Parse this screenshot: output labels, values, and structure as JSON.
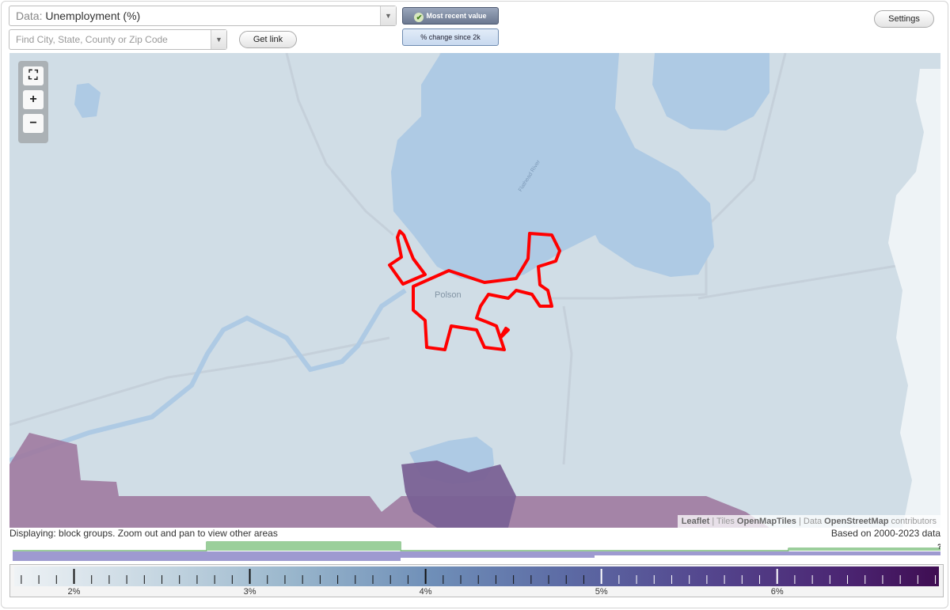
{
  "header": {
    "data_prefix": "Data:",
    "data_value": "Unemployment (%)",
    "search_placeholder": "Find City, State, County or Zip Code",
    "get_link": "Get link",
    "toggle_recent": "Most recent value",
    "toggle_change": "% change since 2k",
    "settings": "Settings"
  },
  "map": {
    "place_label": "Polson",
    "river_label": "Flathead River",
    "zoom_fit_icon": "fullscreen-icon",
    "zoom_in": "+",
    "zoom_out": "−",
    "colors": {
      "land": "#d0dde6",
      "water": "#aecae4",
      "road": "#c5d0da",
      "highlight": "#ff0000",
      "region_fill": "#9e7aa0",
      "region_dark": "#7a6195"
    }
  },
  "attribution": {
    "leaflet": "Leaflet",
    "sep1": " | Tiles ",
    "tiles": "OpenMapTiles",
    "sep2": " | Data ",
    "data": "OpenStreetMap",
    "contrib": " contributors"
  },
  "status": {
    "displaying": "Displaying: block groups. Zoom out and pan to view other areas",
    "based_on": "Based on 2000-2023 data"
  },
  "histogram": {
    "help": "?"
  },
  "legend": {
    "tick_labels": [
      "2%",
      "3%",
      "4%",
      "5%",
      "6%"
    ],
    "min_value": 1.66,
    "max_value": 6.92
  }
}
